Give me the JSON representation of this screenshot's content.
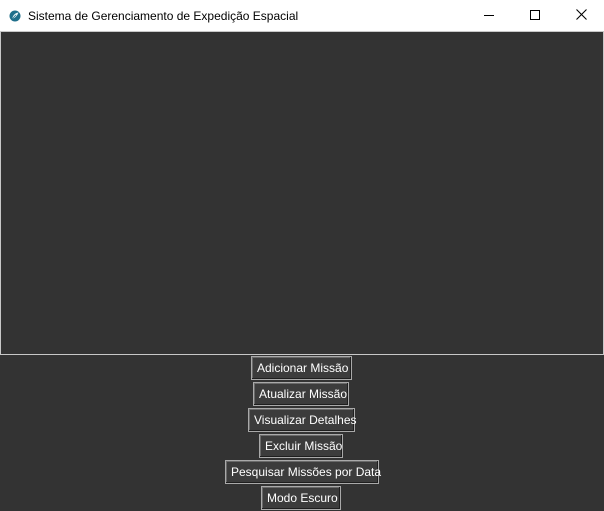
{
  "window": {
    "title": "Sistema de Gerenciamento de Expedição Espacial",
    "icon": "feather-app-icon",
    "controls": [
      "minimize-icon",
      "maximize-icon",
      "close-icon"
    ]
  },
  "colors": {
    "background": "#333333",
    "button_bg": "#3c3c3c",
    "button_text": "#ffffff",
    "titlebar": "#ffffff"
  },
  "actions": {
    "add": "Adicionar Missão",
    "update": "Atualizar Missão",
    "view": "Visualizar Detalhes",
    "delete": "Excluir Missão",
    "search_by_date": "Pesquisar Missões por Data",
    "dark_mode": "Modo Escuro"
  }
}
